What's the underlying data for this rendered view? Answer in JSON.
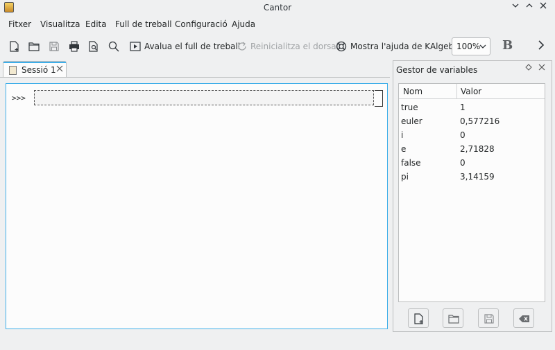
{
  "window": {
    "title": "Cantor"
  },
  "menu": [
    "Fitxer",
    "Visualitza",
    "Edita",
    "Full de treball",
    "Configuració",
    "Ajuda"
  ],
  "toolbar": {
    "evaluate_label": "Avalua el full de treball",
    "restart_label": "Reinicialitza el dorsal",
    "help_label": "Mostra l'ajuda de KAlgebra",
    "zoom_value": "100%",
    "bold_label": "B"
  },
  "tabs": [
    {
      "label": "Sessió 1"
    }
  ],
  "worksheet": {
    "prompt": ">>>"
  },
  "variables": {
    "title": "Gestor de variables",
    "columns": [
      "Nom",
      "Valor"
    ],
    "rows": [
      {
        "name": "true",
        "value": "1"
      },
      {
        "name": "euler",
        "value": "0,577216"
      },
      {
        "name": "i",
        "value": "0"
      },
      {
        "name": "e",
        "value": "2,71828"
      },
      {
        "name": "false",
        "value": "0"
      },
      {
        "name": "pi",
        "value": "3,14159"
      }
    ]
  },
  "icons": {
    "new": "new-document-icon",
    "open": "folder-open-icon",
    "save": "save-icon",
    "print": "print-icon",
    "preview": "print-preview-icon",
    "find": "search-icon",
    "evaluate": "play-icon",
    "restart": "refresh-icon",
    "help": "lifebuoy-icon",
    "more": "chevron-right-icon",
    "clear": "clear-icon"
  },
  "colors": {
    "accent": "#3daee9",
    "background": "#eff0f1",
    "surface": "#fcfcfc"
  }
}
